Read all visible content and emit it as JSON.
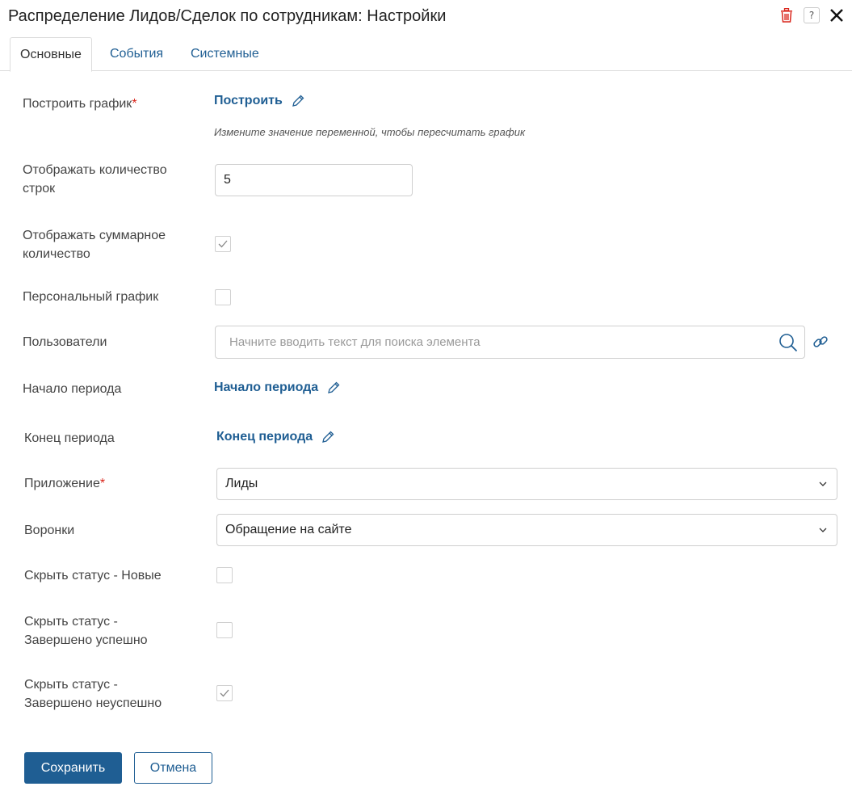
{
  "dialog": {
    "title": "Распределение Лидов/Сделок по сотрудникам: Настройки",
    "help_glyph": "?",
    "colors": {
      "accent": "#1f5e93",
      "required": "#d9261c",
      "delete": "#d9261c"
    }
  },
  "tabs": [
    {
      "label": "Основные",
      "active": true
    },
    {
      "label": "События",
      "active": false
    },
    {
      "label": "Системные",
      "active": false
    }
  ],
  "form": {
    "build_chart": {
      "label": "Построить график",
      "required_mark": "*",
      "link": "Построить",
      "hint": "Измените значение переменной, чтобы пересчитать график"
    },
    "rows_count": {
      "label_line1": "Отображать количество",
      "label_line2": "строк",
      "value": "5"
    },
    "show_total": {
      "label_line1": "Отображать суммарное",
      "label_line2": "количество",
      "checked": true
    },
    "personal_chart": {
      "label": "Персональный график",
      "checked": false
    },
    "users": {
      "label": "Пользователи",
      "placeholder": "Начните вводить текст для поиска элемента"
    },
    "period_start": {
      "label": "Начало периода",
      "link": "Начало периода"
    },
    "period_end": {
      "label": "Конец периода",
      "link": "Конец периода"
    },
    "application": {
      "label": "Приложение",
      "required_mark": "*",
      "value": "Лиды"
    },
    "funnels": {
      "label": "Воронки",
      "value": "Обращение на сайте"
    },
    "hide_new": {
      "label": "Скрыть статус - Новые",
      "checked": false
    },
    "hide_success": {
      "label_line1": "Скрыть статус -",
      "label_line2": "Завершено успешно",
      "checked": false
    },
    "hide_fail": {
      "label_line1": "Скрыть статус -",
      "label_line2": "Завершено неуспешно",
      "checked": true
    }
  },
  "footer": {
    "save_label": "Сохранить",
    "cancel_label": "Отмена"
  }
}
